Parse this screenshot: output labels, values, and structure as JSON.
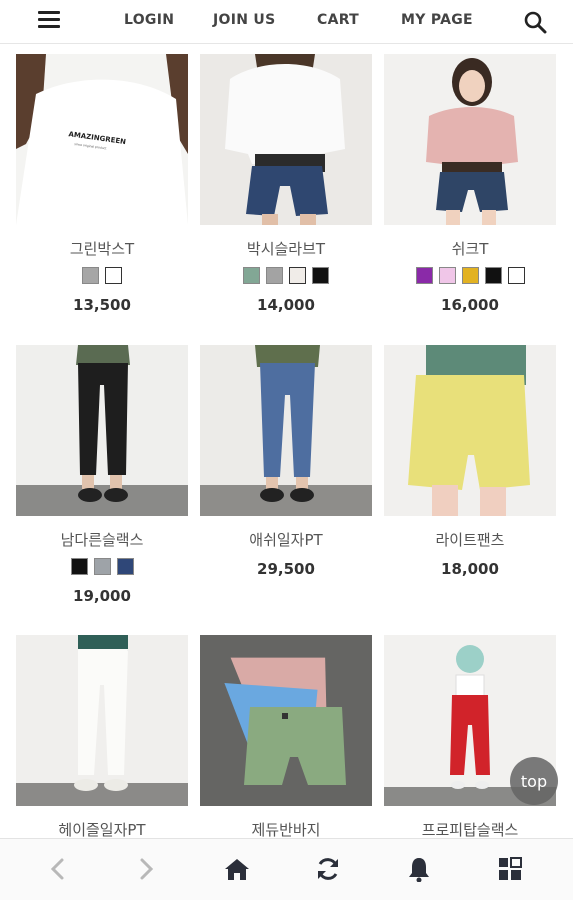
{
  "header": {
    "login": "LOGIN",
    "join": "JOIN US",
    "cart": "CART",
    "mypage": "MY PAGE"
  },
  "products": [
    {
      "name": "그린박스T",
      "price": "13,500",
      "swatches": [
        "#a6a6a6",
        "#ffffff"
      ]
    },
    {
      "name": "박시슬라브T",
      "price": "14,000",
      "swatches": [
        "#82a795",
        "#a3a3a3",
        "#f0ece8",
        "#111111"
      ]
    },
    {
      "name": "쉬크T",
      "price": "16,000",
      "swatches": [
        "#8a2aa8",
        "#f0c6e8",
        "#e2b222",
        "#111111",
        "#ffffff"
      ]
    },
    {
      "name": "남다른슬랙스",
      "price": "19,000",
      "swatches": [
        "#111111",
        "#9ea3a8",
        "#2f4778"
      ]
    },
    {
      "name": "애쉬일자PT",
      "price": "29,500",
      "swatches": []
    },
    {
      "name": "라이트팬츠",
      "price": "18,000",
      "swatches": []
    },
    {
      "name": "헤이즐일자PT",
      "price": "",
      "swatches": []
    },
    {
      "name": "제듀반바지",
      "price": "",
      "swatches": []
    },
    {
      "name": "프로피탑슬랙스",
      "price": "",
      "swatches": []
    }
  ],
  "top_button": "top",
  "bottom_icons": [
    "back-icon",
    "forward-icon",
    "home-icon",
    "refresh-icon",
    "bell-icon",
    "grid-icon"
  ]
}
